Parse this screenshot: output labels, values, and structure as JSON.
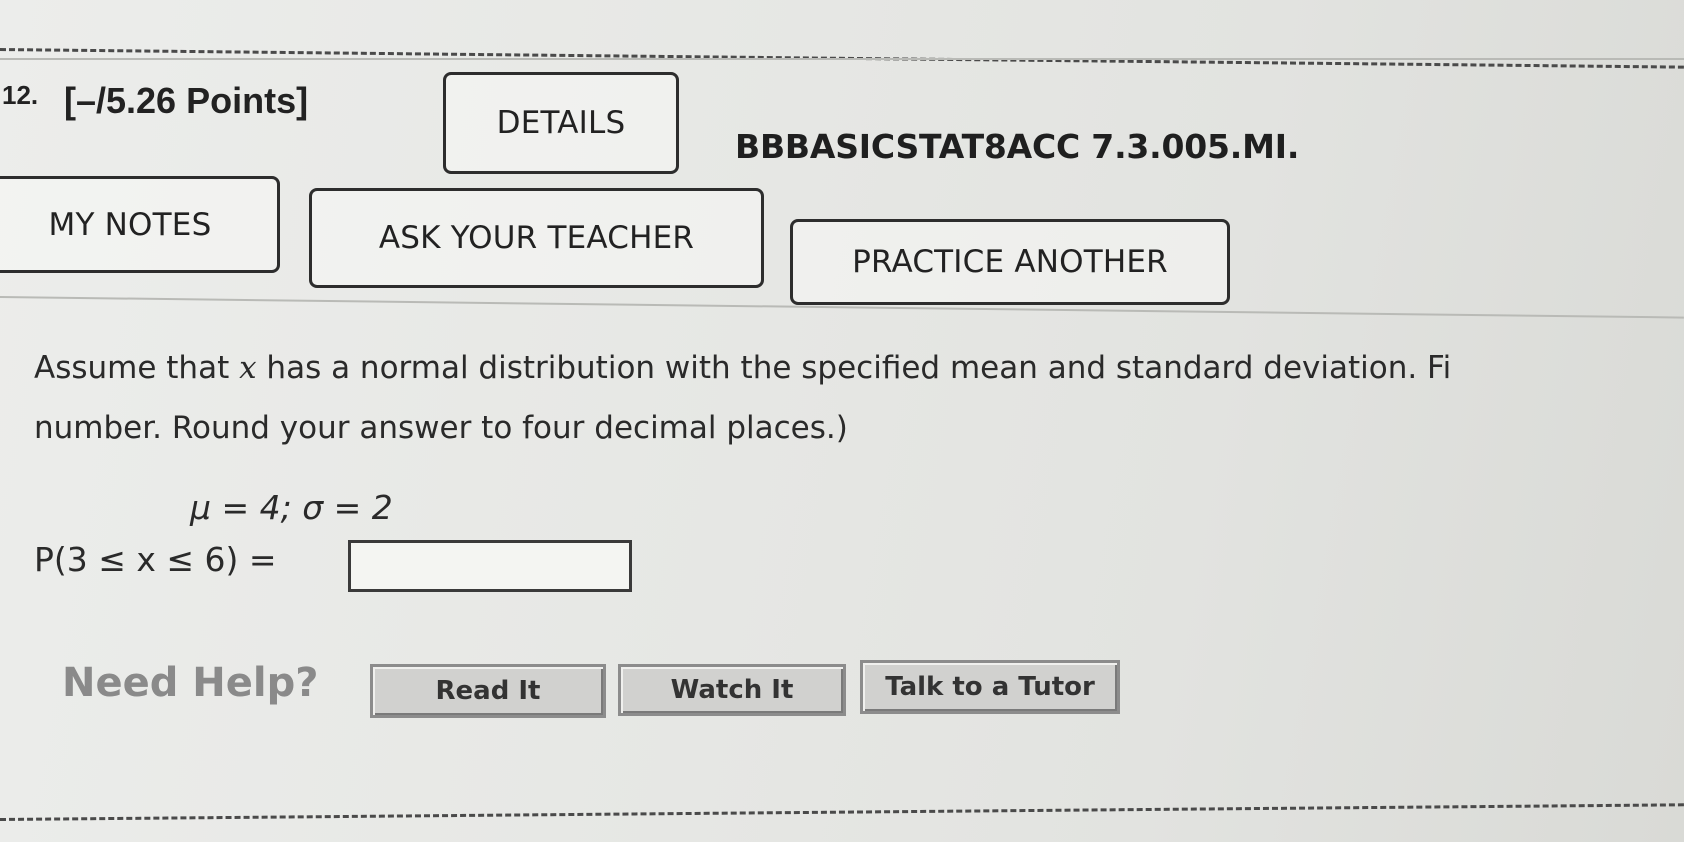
{
  "question": {
    "number": "12.",
    "points": "[–/5.26 Points]",
    "details_label": "DETAILS",
    "code": "BBBASICSTAT8ACC 7.3.005.MI."
  },
  "actions": {
    "my_notes": "MY NOTES",
    "ask_teacher": "ASK YOUR TEACHER",
    "practice_another": "PRACTICE ANOTHER"
  },
  "prompt": {
    "line1_a": "Assume that ",
    "line1_var": "x",
    "line1_b": " has a normal distribution with the specified mean and standard deviation. Fi",
    "line2": "number. Round your answer to four decimal places.)"
  },
  "parameters": "μ = 4; σ = 2",
  "answer": {
    "label": "P(3 ≤ x ≤ 6) =",
    "value": "",
    "placeholder": ""
  },
  "help": {
    "title": "Need Help?",
    "read_it": "Read It",
    "watch_it": "Watch It",
    "talk_to_tutor": "Talk to a Tutor"
  }
}
